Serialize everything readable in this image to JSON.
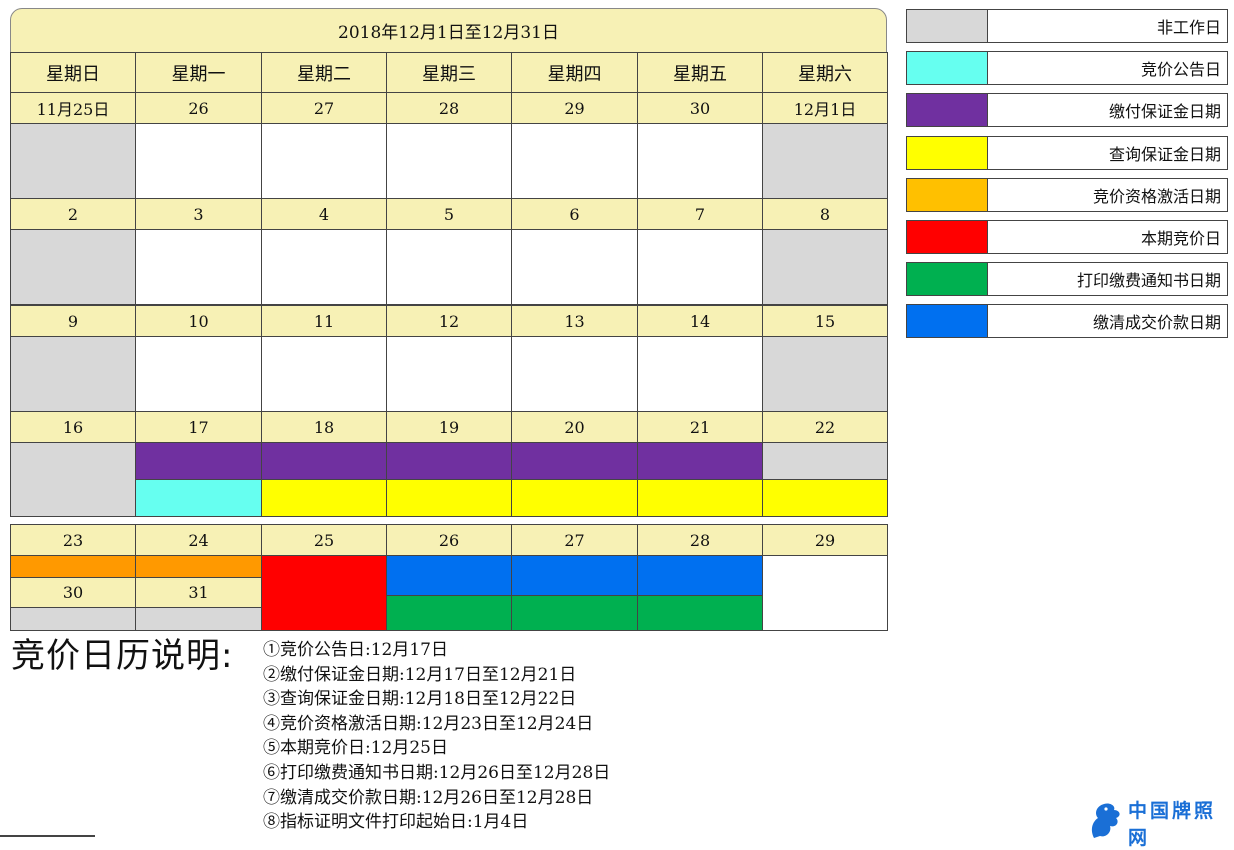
{
  "calendar": {
    "title": "2018年12月1日至12月31日",
    "weekdays": [
      "星期日",
      "星期一",
      "星期二",
      "星期三",
      "星期四",
      "星期五",
      "星期六"
    ],
    "weeks": [
      [
        "11月25日",
        "26",
        "27",
        "28",
        "29",
        "30",
        "12月1日"
      ],
      [
        "2",
        "3",
        "4",
        "5",
        "6",
        "7",
        "8"
      ],
      [
        "9",
        "10",
        "11",
        "12",
        "13",
        "14",
        "15"
      ],
      [
        "16",
        "17",
        "18",
        "19",
        "20",
        "21",
        "22"
      ],
      [
        "23",
        "24",
        "25",
        "26",
        "27",
        "28",
        "29"
      ],
      [
        "30",
        "31"
      ]
    ]
  },
  "legend": [
    {
      "label": "非工作日",
      "color": "#d8d8d8"
    },
    {
      "label": "竞价公告日",
      "color": "#66fff0"
    },
    {
      "label": "缴付保证金日期",
      "color": "#7030a0"
    },
    {
      "label": "查询保证金日期",
      "color": "#ffff00"
    },
    {
      "label": "竞价资格激活日期",
      "color": "#ffc000"
    },
    {
      "label": "本期竞价日",
      "color": "#ff0000"
    },
    {
      "label": "打印缴费通知书日期",
      "color": "#00b050"
    },
    {
      "label": "缴清成交价款日期",
      "color": "#0070f0"
    }
  ],
  "colors": {
    "header_bg": "#f7f1b5",
    "nonwork": "#d8d8d8",
    "activation": "#ff9900"
  },
  "explanation": {
    "title": "竞价日历说明:",
    "notes": [
      "①竞价公告日:12月17日",
      "②缴付保证金日期:12月17日至12月21日",
      "③查询保证金日期:12月18日至12月22日",
      "④竞价资格激活日期:12月23日至12月24日",
      "⑤本期竞价日:12月25日",
      "⑥打印缴费通知书日期:12月26日至12月28日",
      "⑦缴清成交价款日期:12月26日至12月28日",
      "⑧指标证明文件打印起始日:1月4日"
    ]
  },
  "watermark": {
    "text": "中国牌照网",
    "icon": "dragon-logo-icon"
  }
}
